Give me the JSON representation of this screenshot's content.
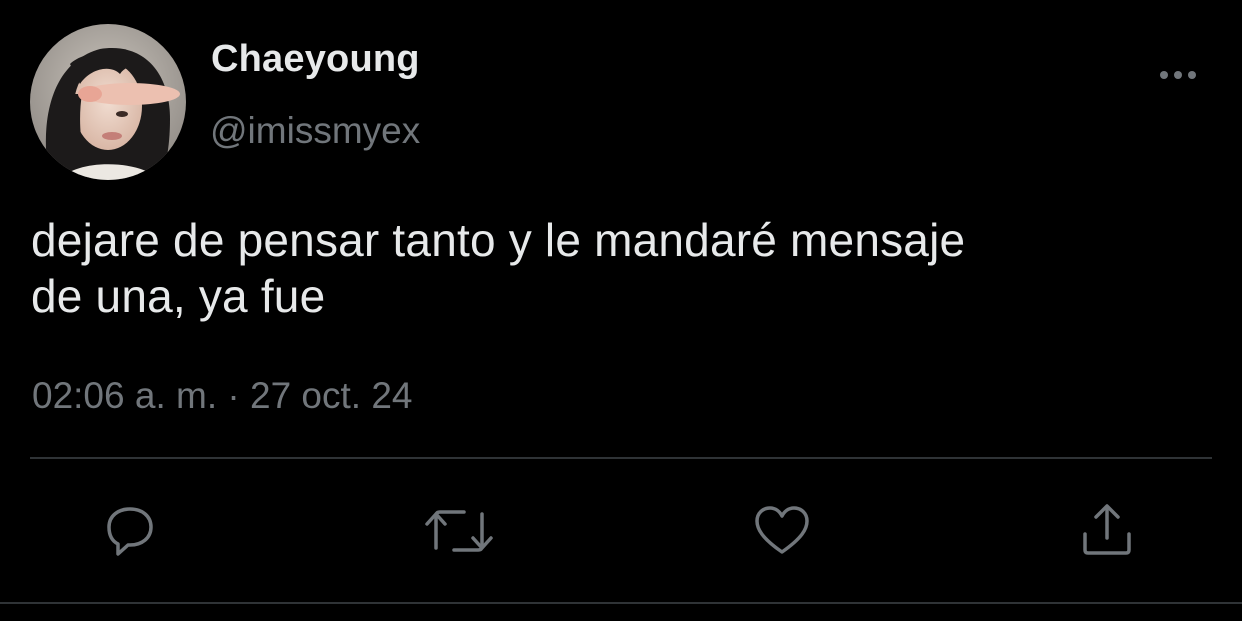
{
  "tweet": {
    "author": {
      "display_name": "Chaeyoung",
      "handle": "@imissmyex",
      "avatar_icon": "profile-photo"
    },
    "text_line1": "dejare de pensar tanto y le mandaré mensaje",
    "text_line2": "de una, ya fue",
    "timestamp": "02:06 a. m. · 27 oct. 24",
    "more_icon": "more-horizontal-icon",
    "actions": [
      {
        "name": "reply",
        "icon": "speech-bubble-icon"
      },
      {
        "name": "retweet",
        "icon": "retweet-arrows-icon"
      },
      {
        "name": "like",
        "icon": "heart-icon"
      },
      {
        "name": "share",
        "icon": "share-upload-icon"
      }
    ]
  },
  "colors": {
    "background": "#000000",
    "primary_text": "#e7e9ea",
    "secondary_text": "#71767b",
    "divider": "#2f3336"
  }
}
